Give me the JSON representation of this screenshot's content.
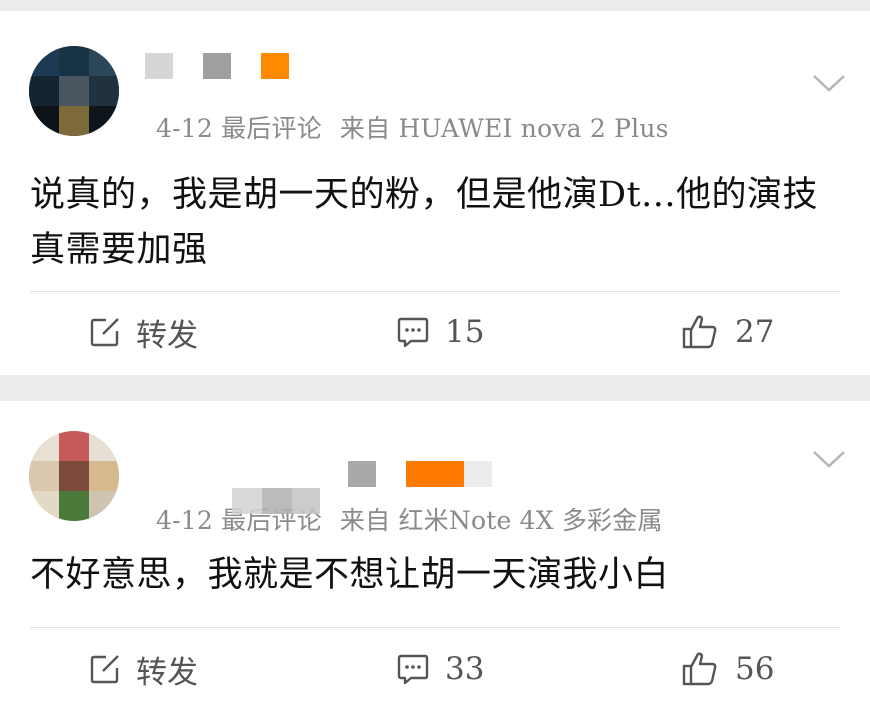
{
  "posts": [
    {
      "meta_date": "4-12 最后评论",
      "meta_source": "来自 HUAWEI nova 2 Plus",
      "content": "说真的，我是胡一天的粉，但是他演Dt...他的演技真需要加强",
      "actions": {
        "repost": "转发",
        "comments": "15",
        "likes": "27"
      }
    },
    {
      "meta_date": "4-12 最后评论",
      "meta_source": "来自 红米Note 4X 多彩金属",
      "content": "不好意思，我就是不想让胡一天演我小白",
      "actions": {
        "repost": "转发",
        "comments": "33",
        "likes": "56"
      }
    }
  ],
  "icons": {
    "repost": "edit-square-icon",
    "comment": "comment-bubble-icon",
    "like": "thumbs-up-icon",
    "more": "chevron-down-icon"
  },
  "colors": {
    "background": "#ececec",
    "card": "#ffffff",
    "meta_text": "#8a8a8a",
    "badge_orange": "#ff8a00"
  }
}
